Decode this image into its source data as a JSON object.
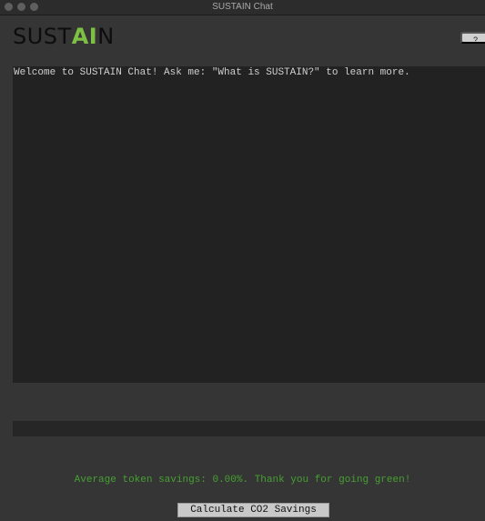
{
  "window": {
    "title": "SUSTAIN Chat"
  },
  "logo": {
    "part1": "SUST",
    "part2": "AI",
    "part3": "N",
    "dark_color": "#0d0d0d",
    "accent_color": "#7dc044"
  },
  "header": {
    "help_label": "?"
  },
  "chat": {
    "messages": [
      "Welcome to SUSTAIN Chat! Ask me: \"What is SUSTAIN?\" to learn more."
    ],
    "input_value": ""
  },
  "footer": {
    "savings_text": "Average token savings: 0.00%. Thank you for going green!",
    "savings_color": "#46a032",
    "calculate_label": "Calculate CO2 Savings"
  }
}
